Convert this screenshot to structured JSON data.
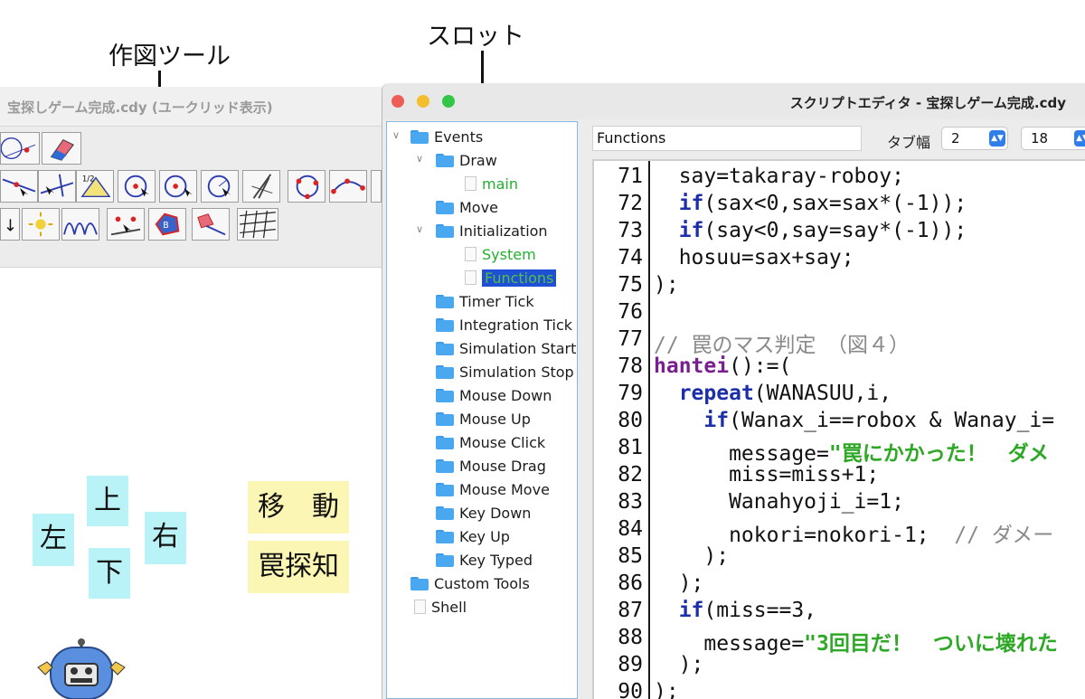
{
  "annotations": {
    "drawing_tools": "作図ツール",
    "slot": "スロット"
  },
  "tool_window": {
    "title": "宝探しゲーム完成.cdy (ユークリッド表示)",
    "canvas_buttons": {
      "up": "上",
      "down": "下",
      "left": "左",
      "right": "右",
      "move": "移　動",
      "trap_detect": "罠探知"
    }
  },
  "editor": {
    "title": "スクリプトエディタ - 宝探しゲーム完成.cdy",
    "function_field": "Functions",
    "tab_width_label": "タブ幅",
    "tab_width_value": "2",
    "font_size_value": "18",
    "tree": {
      "events": "Events",
      "draw": "Draw",
      "main": "main",
      "move": "Move",
      "initialization": "Initialization",
      "system": "System",
      "functions": "Functions",
      "timer_tick": "Timer Tick",
      "integration_tick": "Integration Tick",
      "simulation_start": "Simulation Start",
      "simulation_stop": "Simulation Stop",
      "mouse_down": "Mouse Down",
      "mouse_up": "Mouse Up",
      "mouse_click": "Mouse Click",
      "mouse_drag": "Mouse Drag",
      "mouse_move": "Mouse Move",
      "key_down": "Key Down",
      "key_up": "Key Up",
      "key_typed": "Key Typed",
      "custom_tools": "Custom Tools",
      "shell": "Shell"
    },
    "code": {
      "line_numbers": [
        "71",
        "72",
        "73",
        "74",
        "75",
        "76",
        "77",
        "78",
        "79",
        "80",
        "81",
        "82",
        "83",
        "84",
        "85",
        "86",
        "87",
        "88",
        "89",
        "90"
      ],
      "l71": "  say=takaray-roboy;",
      "l72_kw": "if",
      "l72_rest": "(sax<0,sax=sax*(-1));",
      "l73_kw": "if",
      "l73_rest": "(say<0,say=say*(-1));",
      "l74": "  hosuu=sax+say;",
      "l75": ");",
      "l76": "",
      "l77": "// 罠のマス判定　（図４）",
      "l78_fn": "hantei",
      "l78_rest": "():=(",
      "l79_kw": "repeat",
      "l79_rest": "(WANASUU,i,",
      "l80_kw": "if",
      "l80_rest": "(Wanax_i==robox & Wanay_i=",
      "l81_pre": "      message=",
      "l81_str": "\"罠にかかった！　ダメ",
      "l82": "      miss=miss+1;",
      "l83": "      Wanahyoji_i=1;",
      "l84_code": "      nokori=nokori-1;  ",
      "l84_cmt": "// ダメー",
      "l85": "    );",
      "l86": "  );",
      "l87_kw": "if",
      "l87_rest": "(miss==3,",
      "l88_pre": "    message=",
      "l88_str": "\"3回目だ！　ついに壊れた",
      "l89": "  );",
      "l90": ");"
    }
  },
  "colors": {
    "keyword": "#1c2fa9",
    "function_name": "#7a1f8f",
    "string": "#2fa827",
    "comment": "#8a8a8a",
    "tree_selection": "#1f4fd4",
    "cyan_button": "#b9f3f7",
    "yellow_button": "#fbf6b3"
  },
  "icons": [
    "close-dot",
    "minimize-dot",
    "zoom-dot",
    "folder-icon",
    "file-icon",
    "robot-icon",
    "arrow-icon"
  ]
}
